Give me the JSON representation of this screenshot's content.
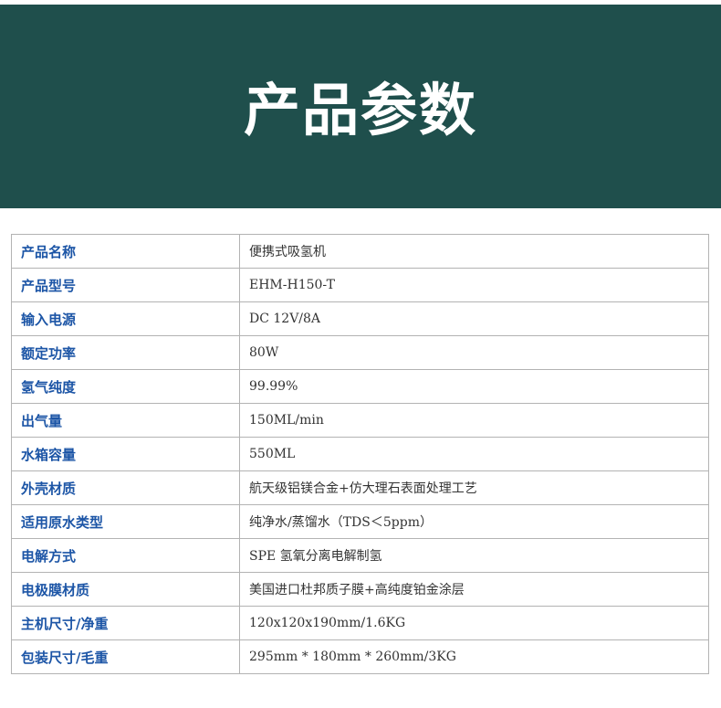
{
  "header": {
    "title": "产品参数"
  },
  "specs": [
    {
      "label": "产品名称",
      "value": "便携式吸氢机"
    },
    {
      "label": "产品型号",
      "value": "EHM-H150-T"
    },
    {
      "label": "输入电源",
      "value": "DC 12V/8A"
    },
    {
      "label": "额定功率",
      "value": "80W"
    },
    {
      "label": "氢气纯度",
      "value": "99.99%"
    },
    {
      "label": "出气量",
      "value": "150ML/min"
    },
    {
      "label": "水箱容量",
      "value": "550ML"
    },
    {
      "label": "外壳材质",
      "value": "航天级铝镁合金+仿大理石表面处理工艺"
    },
    {
      "label": "适用原水类型",
      "value": "纯净水/蒸馏水（TDS＜5ppm）"
    },
    {
      "label": "电解方式",
      "value": "SPE 氢氧分离电解制氢"
    },
    {
      "label": "电极膜材质",
      "value": "美国进口杜邦质子膜+高纯度铂金涂层"
    },
    {
      "label": "主机尺寸/净重",
      "value": "120x120x190mm/1.6KG"
    },
    {
      "label": "包装尺寸/毛重",
      "value": "295mm * 180mm * 260mm/3KG"
    }
  ],
  "colors": {
    "banner_background": "#1f4f4c",
    "label_text": "#1c55a6",
    "value_text": "#333333",
    "table_border": "#b3b3b3"
  }
}
